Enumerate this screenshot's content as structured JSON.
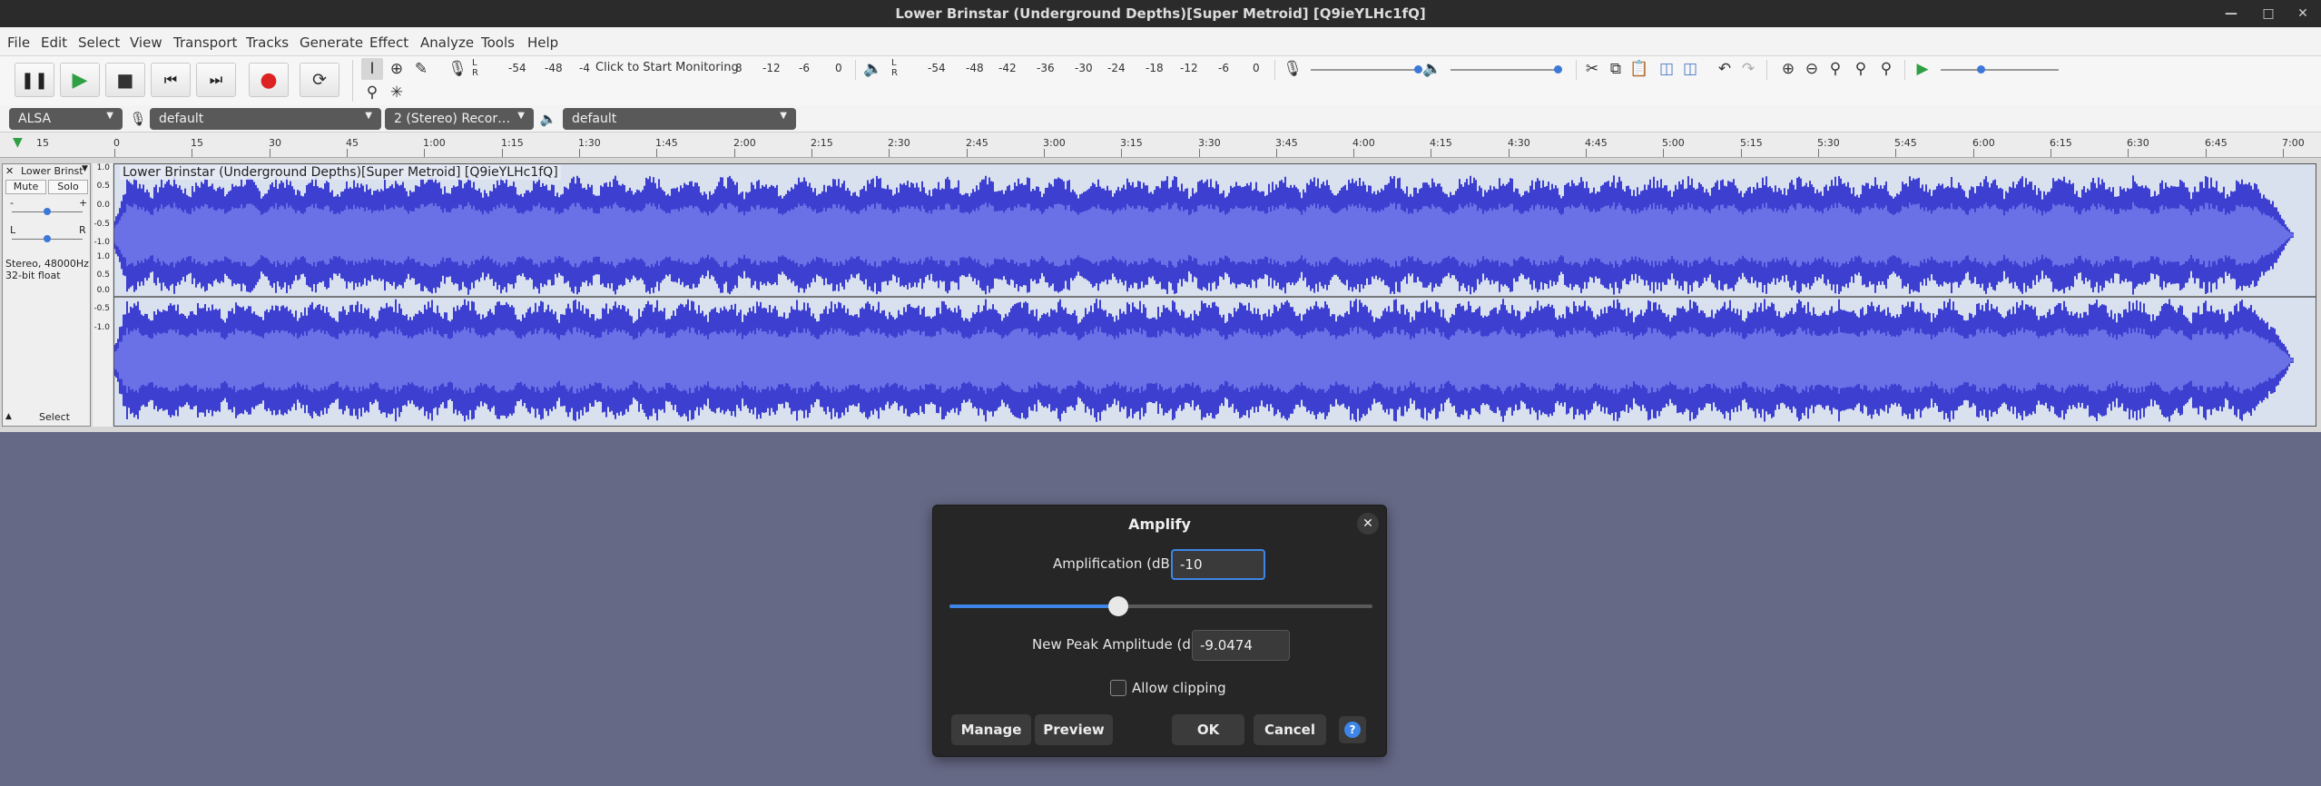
{
  "window": {
    "title": "Lower Brinstar (Underground Depths)[Super Metroid] [Q9ieYLHc1fQ]",
    "minimize_icon": "minimize-icon",
    "maximize_icon": "maximize-icon",
    "close_icon": "close-icon"
  },
  "menu": [
    "File",
    "Edit",
    "Select",
    "View",
    "Transport",
    "Tracks",
    "Generate",
    "Effect",
    "Analyze",
    "Tools",
    "Help"
  ],
  "toolbar": {
    "record_meter_L": "L",
    "record_meter_R": "R",
    "record_meter_ticks": [
      "-54",
      "-48",
      "-4"
    ],
    "monitor_text": "Click to Start Monitoring",
    "record_meter_ticks_after": [
      "8",
      "-12",
      "-6",
      "0"
    ],
    "play_meter_L": "L",
    "play_meter_R": "R",
    "play_meter_ticks": [
      "-54",
      "-48",
      "-42",
      "-36",
      "-30",
      "-24",
      "-18",
      "-12",
      "-6",
      "0"
    ]
  },
  "devices": {
    "host": "ALSA",
    "recording_device": "default",
    "channels": "2 (Stereo) Recor…",
    "playback_device": "default"
  },
  "ruler": {
    "start_label": "15",
    "ticks": [
      "0",
      "15",
      "30",
      "45",
      "1:00",
      "1:15",
      "1:30",
      "1:45",
      "2:00",
      "2:15",
      "2:30",
      "2:45",
      "3:00",
      "3:15",
      "3:30",
      "3:45",
      "4:00",
      "4:15",
      "4:30",
      "4:45",
      "5:00",
      "5:15",
      "5:30",
      "5:45",
      "6:00",
      "6:15",
      "6:30",
      "6:45",
      "7:00"
    ]
  },
  "track": {
    "short_name": "Lower Brinst",
    "name": "Lower Brinstar (Underground Depths)[Super Metroid] [Q9ieYLHc1fQ]",
    "mute_label": "Mute",
    "solo_label": "Solo",
    "gain_minus": "-",
    "gain_plus": "+",
    "pan_left": "L",
    "pan_right": "R",
    "info_line1": "Stereo, 48000Hz",
    "info_line2": "32-bit float",
    "select_label": "Select",
    "scale_labels": [
      "1.0",
      "0.5",
      "0.0",
      "-0.5",
      "-1.0"
    ],
    "waveform_color": "#3c3fd0",
    "waveform_rms_color": "#6a70e6"
  },
  "dialog": {
    "title": "Amplify",
    "amplification_label": "Amplification (dB):",
    "amplification_value": "-10",
    "slider_fraction": 0.4,
    "peak_label": "New Peak Amplitude (dB):",
    "peak_value": "-9.0474",
    "allow_clipping_label": "Allow clipping",
    "allow_clipping_checked": false,
    "manage_label": "Manage",
    "preview_label": "Preview",
    "ok_label": "OK",
    "cancel_label": "Cancel",
    "help_label": "?"
  }
}
